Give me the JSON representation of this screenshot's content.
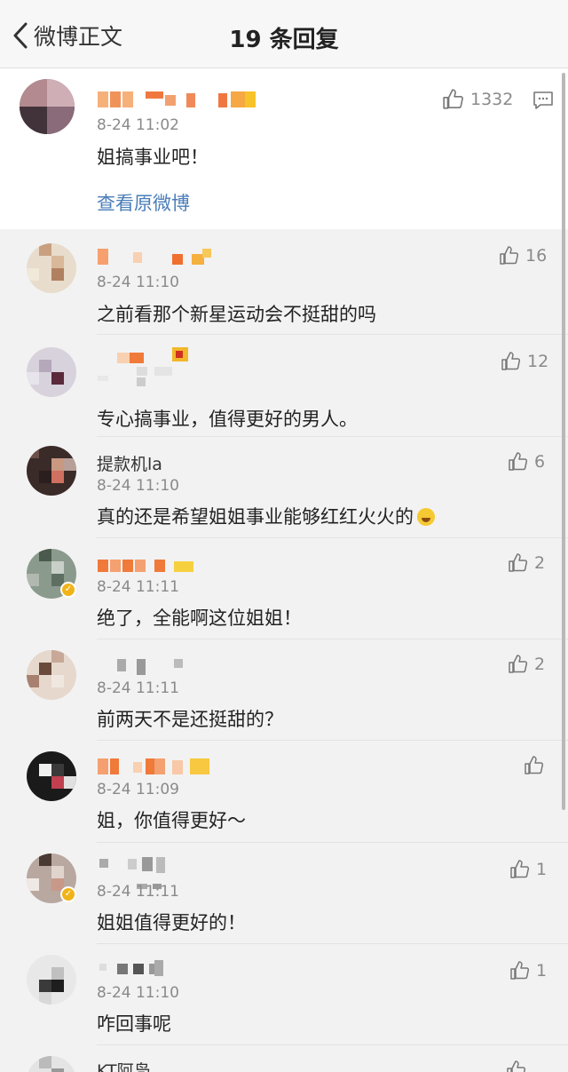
{
  "nav": {
    "back_label": "微博正文",
    "title": "19 条回复"
  },
  "main_comment": {
    "time": "8-24 11:02",
    "content": "姐搞事业吧！",
    "like_count": "1332",
    "view_original": "查看原微博"
  },
  "replies": [
    {
      "name": "",
      "time": "8-24 11:10",
      "content": "之前看那个新星运动会不挺甜的吗",
      "likes": "16"
    },
    {
      "name": "",
      "time": "",
      "content": "专心搞事业，值得更好的男人。",
      "likes": "12"
    },
    {
      "name": "提款机la",
      "time": "8-24 11:10",
      "content": "真的还是希望姐姐事业能够红红火火的",
      "likes": "6"
    },
    {
      "name": "",
      "time": "8-24 11:11",
      "content": "绝了，全能啊这位姐姐！",
      "likes": "2"
    },
    {
      "name": "",
      "time": "8-24 11:11",
      "content": "前两天不是还挺甜的？",
      "likes": "2"
    },
    {
      "name": "",
      "time": "8-24 11:09",
      "content": "姐，你值得更好～",
      "likes": ""
    },
    {
      "name": "",
      "time": "8-24 11:11",
      "content": "姐姐值得更好的！",
      "likes": "1"
    },
    {
      "name": "",
      "time": "8-24 11:10",
      "content": "咋回事呢",
      "likes": "1"
    },
    {
      "name": "KT阿凫",
      "time": "",
      "content": "",
      "likes": ""
    }
  ],
  "icons": {
    "back": "chevron-left-icon",
    "like": "thumbs-up-icon",
    "comment": "comment-icon",
    "verified": "verified-badge-icon",
    "emoji": "laughing-tears-emoji"
  },
  "colors": {
    "link": "#4a7db8",
    "time": "#8a8a8a",
    "verified": "#f0b41a"
  }
}
